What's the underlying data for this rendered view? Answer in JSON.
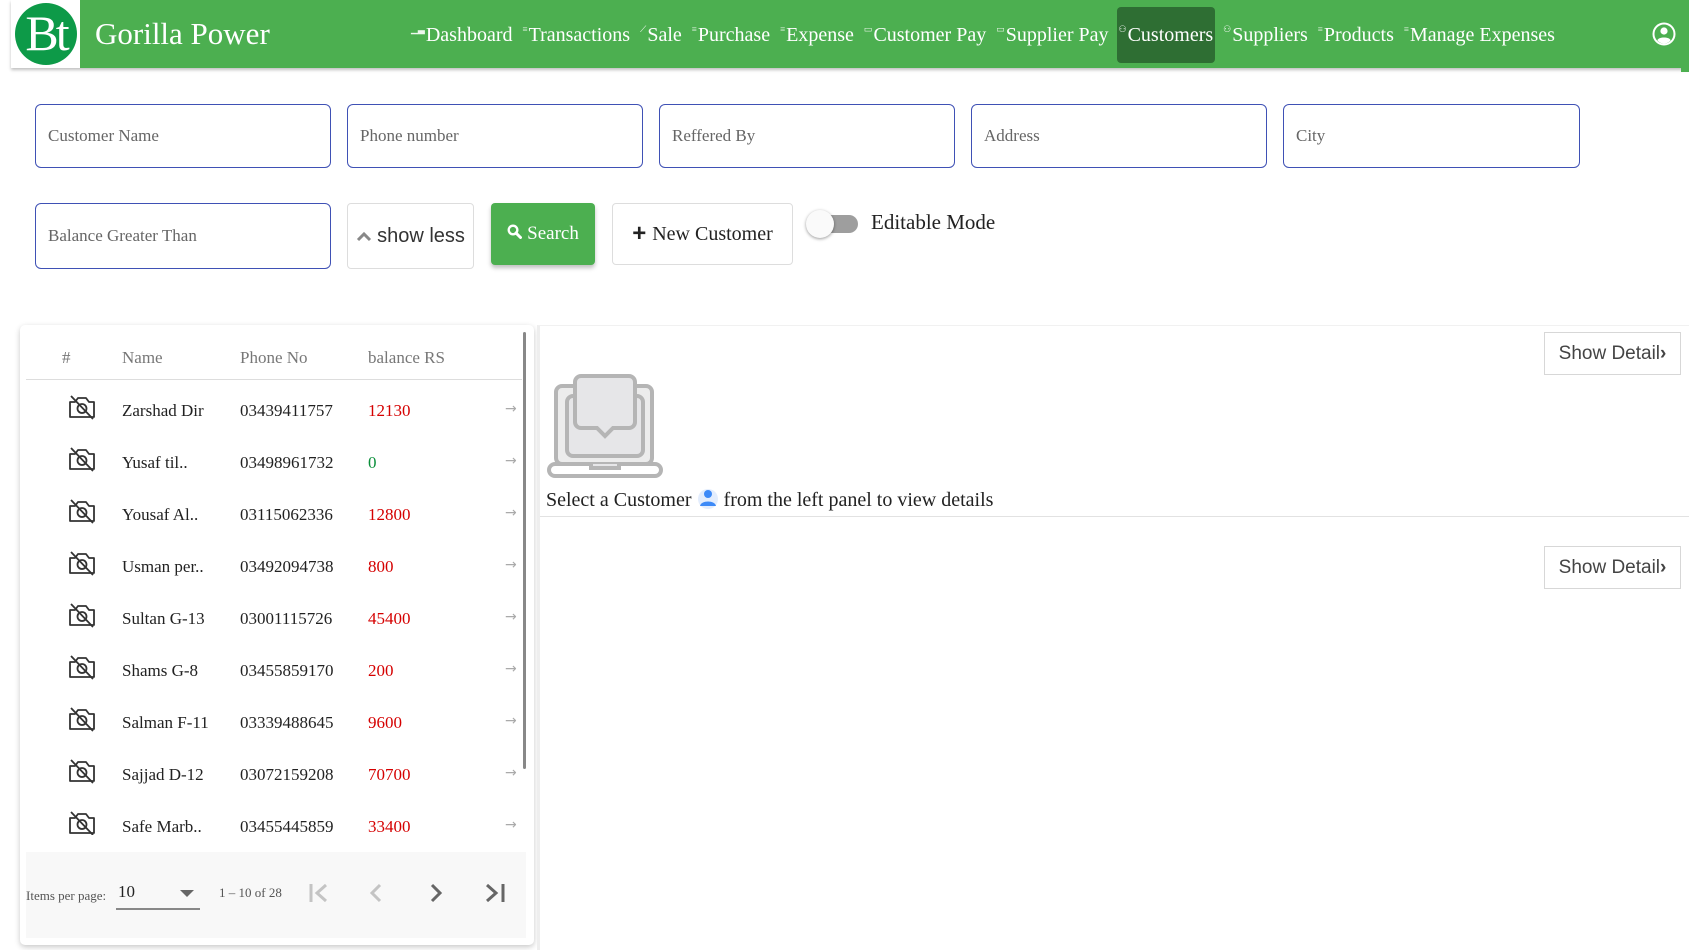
{
  "app": {
    "logo_text": "Bt",
    "brand": "Gorilla Power"
  },
  "nav": {
    "items": [
      {
        "label": "Dashboard",
        "icon": "bar-chart-icon",
        "glyph": "▁▃",
        "active": false
      },
      {
        "label": "Transactions",
        "icon": "list-icon",
        "glyph": "≡",
        "active": false
      },
      {
        "label": "Sale",
        "icon": "trending-up-icon",
        "glyph": "⟋",
        "active": false
      },
      {
        "label": "Purchase",
        "icon": "list-icon",
        "glyph": "≡",
        "active": false
      },
      {
        "label": "Expense",
        "icon": "list-icon",
        "glyph": "≡",
        "active": false
      },
      {
        "label": "Customer Pay",
        "icon": "wallet-icon",
        "glyph": "▭",
        "active": false
      },
      {
        "label": "Supplier Pay",
        "icon": "wallet-icon",
        "glyph": "▭",
        "active": false
      },
      {
        "label": "Customers",
        "icon": "people-icon",
        "glyph": "⚇",
        "active": true
      },
      {
        "label": "Suppliers",
        "icon": "people-icon",
        "glyph": "⚇",
        "active": false
      },
      {
        "label": "Products",
        "icon": "list-icon",
        "glyph": "≡",
        "active": false
      },
      {
        "label": "Manage Expenses",
        "icon": "list-icon",
        "glyph": "≡",
        "active": false
      }
    ],
    "user_icon": "account-circle-icon"
  },
  "filters": {
    "customer_name": {
      "placeholder": "Customer Name",
      "value": ""
    },
    "phone": {
      "placeholder": "Phone number",
      "value": ""
    },
    "referred_by": {
      "placeholder": "Reffered By",
      "value": ""
    },
    "address": {
      "placeholder": "Address",
      "value": ""
    },
    "city": {
      "placeholder": "City",
      "value": ""
    },
    "balance_gt": {
      "placeholder": "Balance Greater Than",
      "value": ""
    },
    "show_less_label": "show less",
    "search_label": "Search",
    "new_customer_label": "New Customer",
    "editable_mode_label": "Editable Mode",
    "editable_mode_on": false
  },
  "list": {
    "columns": [
      "#",
      "Name",
      "Phone No",
      "balance RS"
    ],
    "rows": [
      {
        "name": "Zarshad Dir",
        "phone": "03439411757",
        "balance": "12130",
        "status": "red"
      },
      {
        "name": "Yusaf til..",
        "phone": "03498961732",
        "balance": "0",
        "status": "green"
      },
      {
        "name": "Yousaf Al..",
        "phone": "03115062336",
        "balance": "12800",
        "status": "red"
      },
      {
        "name": "Usman per..",
        "phone": "03492094738",
        "balance": "800",
        "status": "red"
      },
      {
        "name": "Sultan G-13",
        "phone": "03001115726",
        "balance": "45400",
        "status": "red"
      },
      {
        "name": "Shams G-8",
        "phone": "03455859170",
        "balance": "200",
        "status": "red"
      },
      {
        "name": "Salman F-11",
        "phone": "03339488645",
        "balance": "9600",
        "status": "red"
      },
      {
        "name": "Sajjad D-12",
        "phone": "03072159208",
        "balance": "70700",
        "status": "red"
      },
      {
        "name": "Safe Marb..",
        "phone": "03455445859",
        "balance": "33400",
        "status": "red"
      }
    ],
    "row_arrow": "→"
  },
  "paginator": {
    "items_per_page_label": "Items per page:",
    "items_per_page": "10",
    "range_label": "1 – 10 of 28"
  },
  "detail": {
    "empty_message_before": "Select a Customer",
    "empty_message_after": "from the left panel to view details",
    "show_detail_label": "Show Detail",
    "show_detail_chevron": "›"
  },
  "colors": {
    "primary_green": "#4caf50",
    "active_nav": "#2e6e33",
    "field_border": "#3f51b5",
    "balance_due": "#d50000",
    "balance_zero": "#0a8f3a",
    "person_icon": "#3d8af7"
  }
}
